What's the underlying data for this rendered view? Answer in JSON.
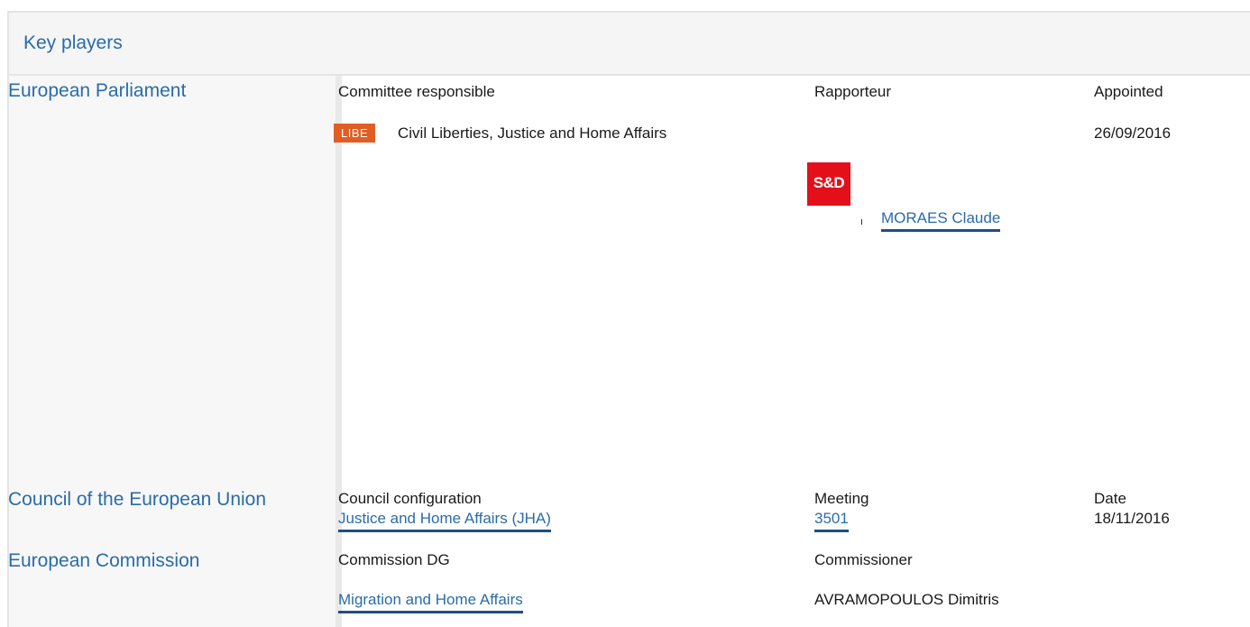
{
  "header": {
    "title": "Key players"
  },
  "parliament": {
    "title": "European Parliament",
    "col_committee": "Committee responsible",
    "col_rapporteur": "Rapporteur",
    "col_appointed": "Appointed",
    "badge": "LIBE",
    "committee": "Civil Liberties, Justice and Home Affairs",
    "appointed_date": "26/09/2016",
    "group_logo": "S&D",
    "rapporteur": "MORAES Claude",
    "colors": {
      "badge": "#e05e24",
      "logo": "#e3101a"
    }
  },
  "council": {
    "title": "Council of the European Union",
    "col_configuration": "Council configuration",
    "col_meeting": "Meeting",
    "col_date": "Date",
    "configuration": "Justice and Home Affairs (JHA)",
    "meeting": "3501",
    "date": "18/11/2016"
  },
  "commission": {
    "title": "European Commission",
    "col_dg": "Commission DG",
    "col_commissioner": "Commissioner",
    "dg": "Migration and Home Affairs",
    "commissioner": "AVRAMOPOULOS Dimitris"
  },
  "accent_color": "#2a6ca8"
}
